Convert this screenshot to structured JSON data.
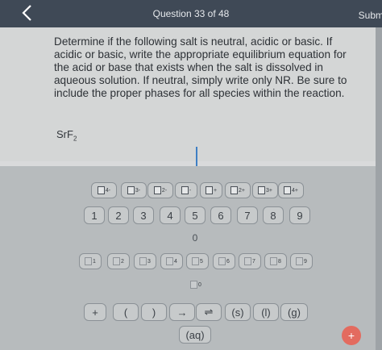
{
  "header": {
    "question_counter": "Question 33 of 48",
    "submit_label": "Subm"
  },
  "question": {
    "prompt": "Determine if the following salt is neutral, acidic or basic. If acidic or basic, write the appropriate equilibrium equation for the acid or base that exists when the salt is dissolved in aqueous solution. If neutral, simply write only NR. Be sure to include the proper phases for all species within the reaction.",
    "salt_base": "SrF",
    "salt_sub": "2"
  },
  "keypad": {
    "charge_keys": [
      "4-",
      "3-",
      "2-",
      "-",
      "+",
      "2+",
      "3+",
      "4+"
    ],
    "number_keys": [
      "1",
      "2",
      "3",
      "4",
      "5",
      "6",
      "7",
      "8",
      "9"
    ],
    "zero_key": "0",
    "subscript_keys": [
      "1",
      "2",
      "3",
      "4",
      "5",
      "6",
      "7",
      "8",
      "9"
    ],
    "subscript_zero": "0",
    "symbol_keys": [
      "+",
      "(",
      ")",
      "→",
      "⇌",
      "(s)",
      "(l)",
      "(g)"
    ],
    "aq_key": "(aq)",
    "fab_label": "+"
  },
  "colors": {
    "header_bg": "#3f4956",
    "content_bg": "#d4d6d6",
    "keypad_bg": "#b7bbbd",
    "cursor": "#3e7fc4",
    "fab": "#e36b5f"
  }
}
